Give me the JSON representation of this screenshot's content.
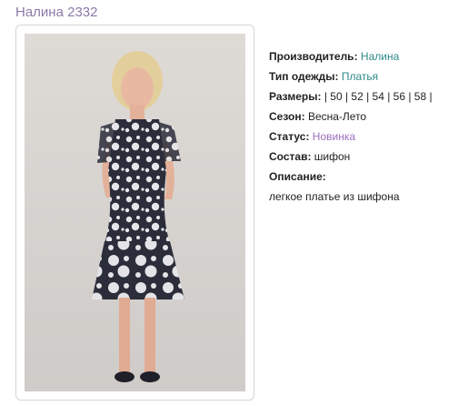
{
  "page": {
    "title": "Налина 2332"
  },
  "product": {
    "photo_icon": "dress-photo",
    "manufacturer": {
      "label": "Производитель:",
      "value": "Налина"
    },
    "clothing_type": {
      "label": "Тип одежды:",
      "value": "Платья"
    },
    "sizes": {
      "label": "Размеры:",
      "value": "| 50 | 52 | 54 | 56 | 58 |"
    },
    "season": {
      "label": "Сезон:",
      "value": "Весна-Лето"
    },
    "status": {
      "label": "Статус:",
      "value": "Новинка"
    },
    "composition": {
      "label": "Состав:",
      "value": "шифон"
    },
    "description": {
      "label": "Описание:",
      "value": "легкое платье из шифона"
    }
  },
  "colors": {
    "title": "#8a7aa8",
    "link": "#2f8a8a",
    "status": "#9b6fc0",
    "photo_bg": "#d7d4d1",
    "dress": "#2b2d3a"
  }
}
